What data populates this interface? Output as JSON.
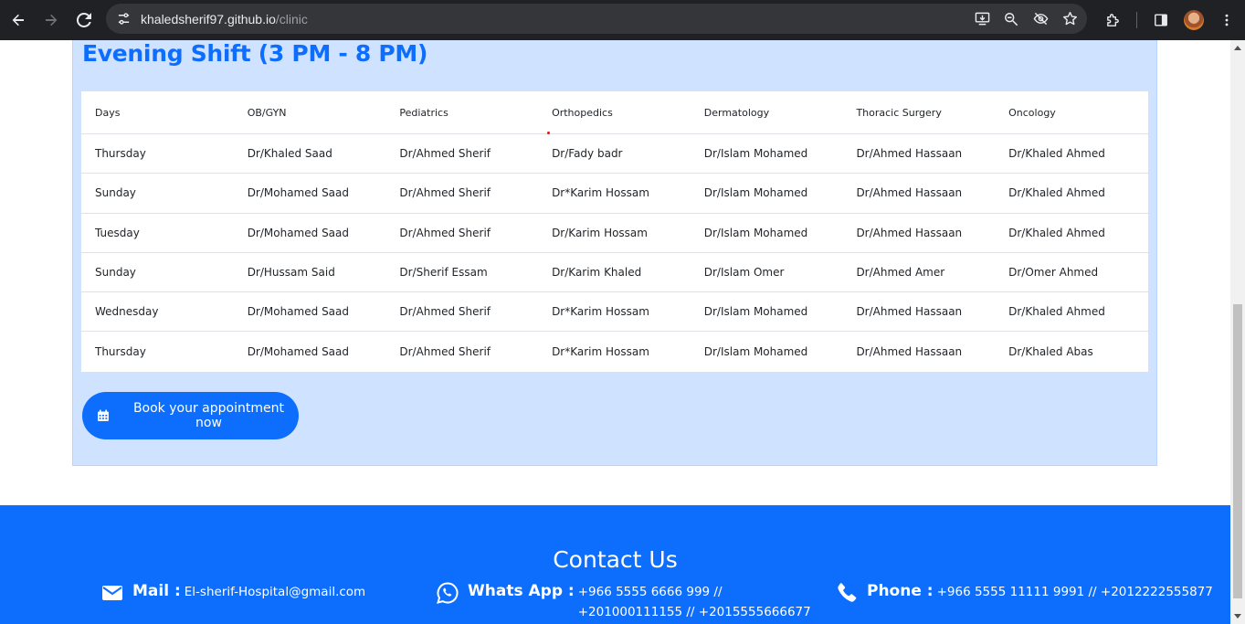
{
  "browser": {
    "url_host": "khaledsherif97.github.io",
    "url_path": "/clinic"
  },
  "schedule": {
    "title": "Evening Shift (3 PM - 8 PM)",
    "columns": [
      "Days",
      "OB/GYN",
      "Pediatrics",
      "Orthopedics",
      "Dermatology",
      "Thoracic Surgery",
      "Oncology"
    ],
    "rows": [
      [
        "Thursday",
        "Dr/Khaled Saad",
        "Dr/Ahmed Sherif",
        "Dr/Fady badr",
        "Dr/Islam Mohamed",
        "Dr/Ahmed Hassaan",
        "Dr/Khaled Ahmed"
      ],
      [
        "Sunday",
        "Dr/Mohamed Saad",
        "Dr/Ahmed Sherif",
        "Dr*Karim Hossam",
        "Dr/Islam Mohamed",
        "Dr/Ahmed Hassaan",
        "Dr/Khaled Ahmed"
      ],
      [
        "Tuesday",
        "Dr/Mohamed Saad",
        "Dr/Ahmed Sherif",
        "Dr/Karim Hossam",
        "Dr/Islam Mohamed",
        "Dr/Ahmed Hassaan",
        "Dr/Khaled Ahmed"
      ],
      [
        "Sunday",
        "Dr/Hussam Said",
        "Dr/Sherif Essam",
        "Dr/Karim Khaled",
        "Dr/Islam Omer",
        "Dr/Ahmed Amer",
        "Dr/Omer Ahmed"
      ],
      [
        "Wednesday",
        "Dr/Mohamed Saad",
        "Dr/Ahmed Sherif",
        "Dr*Karim Hossam",
        "Dr/Islam Mohamed",
        "Dr/Ahmed Hassaan",
        "Dr/Khaled Ahmed"
      ],
      [
        "Thursday",
        "Dr/Mohamed Saad",
        "Dr/Ahmed Sherif",
        "Dr*Karim Hossam",
        "Dr/Islam Mohamed",
        "Dr/Ahmed Hassaan",
        "Dr/Khaled Abas"
      ]
    ],
    "book_button": "Book your appointment now"
  },
  "contact": {
    "title": "Contact Us",
    "mail_label": "Mail :",
    "mail_value": "El-sherif-Hospital@gmail.com",
    "whatsapp_label": "Whats App :",
    "whatsapp_value": "+966 5555 6666 999 // +201000111155 // +2015555666677",
    "phone_label": "Phone :",
    "phone_value": "+966 5555 11111 9991 // +2012222555877"
  },
  "colors": {
    "primary": "#0d6efd",
    "section_bg": "#cfe2ff",
    "chrome_bg": "#202124"
  }
}
